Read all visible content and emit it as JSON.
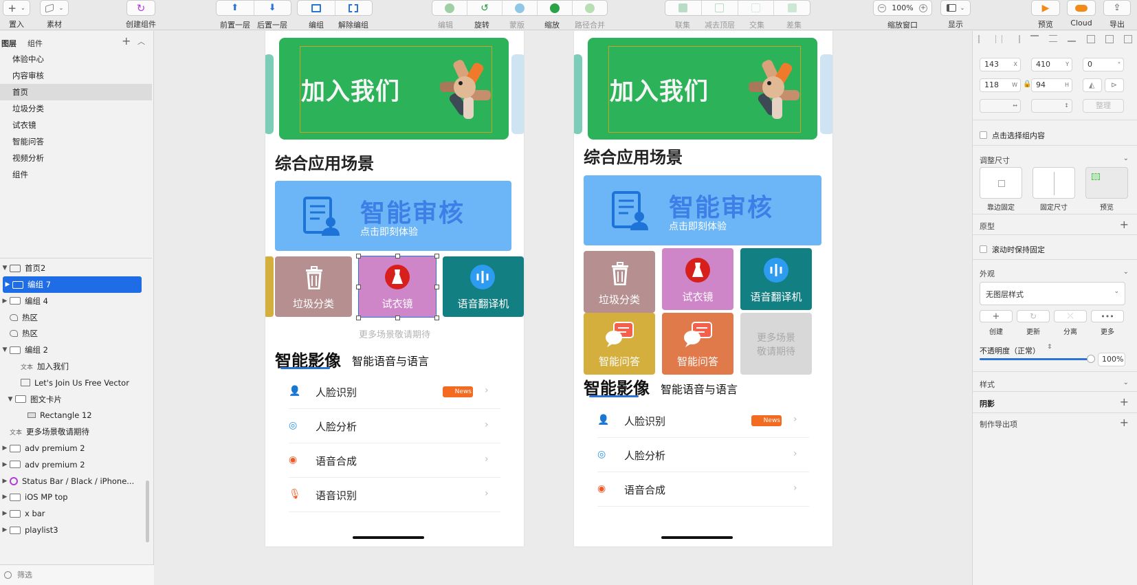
{
  "toolbar": {
    "insert": "置入",
    "assets": "素材",
    "create_component": "创建组件",
    "bring_forward": "前置一层",
    "send_backward": "后置一层",
    "group": "编组",
    "ungroup": "解除编组",
    "edit": "编辑",
    "rotate": "旋转",
    "mask": "蒙版",
    "scale": "缩放",
    "path_merge": "路径合并",
    "union": "联集",
    "subtract": "减去顶层",
    "intersect": "交集",
    "difference": "差集",
    "zoom_value": "100%",
    "zoom_window": "缩放窗口",
    "display": "显示",
    "preview": "预览",
    "cloud": "Cloud",
    "export": "导出"
  },
  "left_panel": {
    "tab_layers": "图层",
    "tab_components": "组件",
    "pages": [
      "体验中心",
      "内容审核",
      "首页",
      "垃圾分类",
      "试衣镜",
      "智能问答",
      "视频分析",
      "组件"
    ],
    "selected_page": "首页",
    "artboard": "首页2",
    "layers": [
      {
        "label": "编组 7",
        "type": "folder",
        "selected": true
      },
      {
        "label": "编组 4",
        "type": "folder"
      },
      {
        "label": "热区",
        "type": "hotspot"
      },
      {
        "label": "热区",
        "type": "hotspot"
      },
      {
        "label": "编组 2",
        "type": "folder"
      },
      {
        "label": "加入我们",
        "type": "text",
        "type_tag": "文本"
      },
      {
        "label": "Let's Join Us Free Vector",
        "type": "image"
      },
      {
        "label": "图文卡片",
        "type": "folder"
      },
      {
        "label": "Rectangle 12",
        "type": "rect"
      },
      {
        "label": "更多场景敬请期待",
        "type": "text",
        "type_tag": "文本"
      },
      {
        "label": "adv premium 2",
        "type": "folder"
      },
      {
        "label": "adv premium 2",
        "type": "folder"
      },
      {
        "label": "Status Bar / Black / iPhone...",
        "type": "symbol"
      },
      {
        "label": "iOS MP top",
        "type": "folder"
      },
      {
        "label": "x bar",
        "type": "folder"
      },
      {
        "label": "playlist3",
        "type": "folder"
      }
    ],
    "filter_placeholder": "筛选"
  },
  "artboard_a": {
    "banner_text": "加入我们",
    "section_title": "综合应用场景",
    "audit_title": "智能审核",
    "audit_sub": "点击即刻体验",
    "tiles": [
      "垃圾分类",
      "试衣镜",
      "语音翻译机"
    ],
    "more_text": "更多场景敬请期待",
    "tab_active": "智能影像",
    "tab_other": "智能语音与语言",
    "list": [
      "人脸识别",
      "人脸分析",
      "语音合成",
      "语音识别"
    ],
    "badge": "News"
  },
  "artboard_b": {
    "banner_text": "加入我们",
    "section_title": "综合应用场景",
    "audit_title": "智能审核",
    "audit_sub": "点击即刻体验",
    "tiles": [
      "垃圾分类",
      "试衣镜",
      "语音翻译机",
      "智能问答",
      "智能问答",
      "更多场景",
      "敬请期待"
    ],
    "tab_active": "智能影像",
    "tab_other": "智能语音与语言",
    "list": [
      "人脸识别",
      "人脸分析",
      "语音合成"
    ],
    "badge": "News"
  },
  "inspector": {
    "x": "143",
    "x_unit": "X",
    "y": "410",
    "y_unit": "Y",
    "rotation": "0",
    "rotation_unit": "°",
    "w": "118",
    "w_unit": "W",
    "h": "94",
    "h_unit": "H",
    "tidy": "整理",
    "click_select_group": "点击选择组内容",
    "resize_section": "调整尺寸",
    "resize_pin": "靠边固定",
    "resize_fixed": "固定尺寸",
    "resize_preview": "预览",
    "prototype": "原型",
    "fix_scroll": "滚动时保持固定",
    "appearance": "外观",
    "layer_style": "无图层样式",
    "style_actions": [
      "创建",
      "更新",
      "分离",
      "更多"
    ],
    "opacity_label": "不透明度（正常）",
    "opacity_value": "100%",
    "opacity": 1.0,
    "style": "样式",
    "shadow": "阴影",
    "export_item": "制作导出项"
  },
  "colors": {
    "selection": "#1f6de6",
    "banner": "#2cb35a",
    "audit": "#6cb6f7",
    "trash_tile": "#b69090",
    "mirror_tile": "#cf86c9",
    "voice_tile": "#127f83",
    "qa_tile_1": "#d4af3d",
    "qa_tile_2": "#e07a4b",
    "more_tile": "#d8d8d8",
    "news": "#f36a21"
  }
}
